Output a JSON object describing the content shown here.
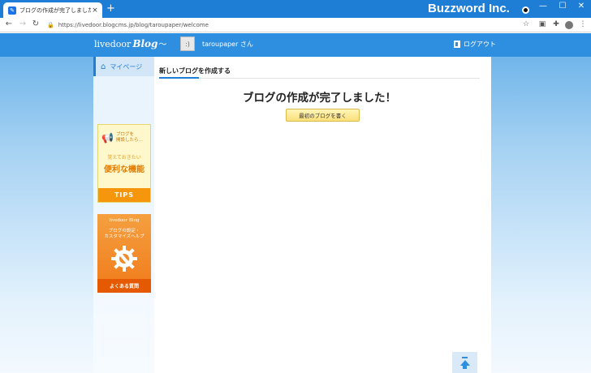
{
  "browser": {
    "tab_title": "ブログの作成が完了しました | livedo",
    "tab_close": "×",
    "new_tab": "+",
    "url": "https://livedoor.blogcms.jp/blog/taroupaper/welcome",
    "watermark": "Buzzword Inc.",
    "window_controls": [
      "—",
      "☐",
      "✕"
    ]
  },
  "header": {
    "logo_text": "livedoor",
    "logo_blog": "Blog",
    "username": "taroupaper さん",
    "logout_label": "ログアウト"
  },
  "sidebar": {
    "mypage_label": "マイページ",
    "tips_banner": {
      "line1": "ブログを",
      "line2": "開設したら…",
      "subtitle": "覚えておきたい",
      "title": "便利な機能",
      "footer": "TIPS"
    },
    "help_banner": {
      "logo": "livedoor Blog",
      "line1": "ブログの設定・",
      "line2": "カスタマイズヘルプ",
      "footer": "よくある質問"
    }
  },
  "main": {
    "section_title": "新しいブログを作成する",
    "headline": "ブログの作成が完了しました！",
    "write_button": "最初のブログを書く"
  },
  "colors": {
    "header_blue": "#2e8fe0",
    "chrome_blue": "#1e7ed6",
    "tips_orange": "#f5960c",
    "help_orange": "#e55a00",
    "button_yellow": "#fbe07a"
  }
}
